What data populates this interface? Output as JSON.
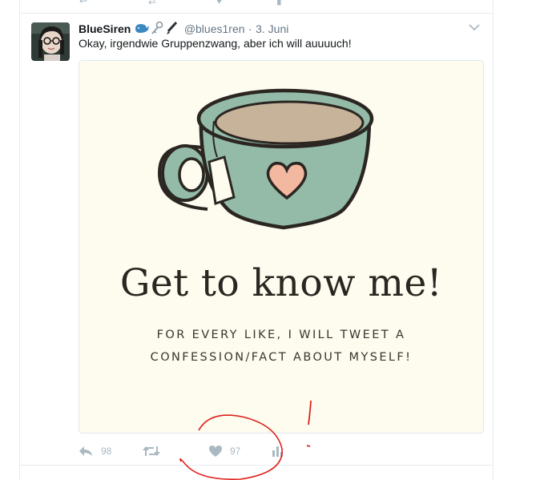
{
  "tweet": {
    "author_name": "BlueSiren",
    "author_emoji": "🐋🗝🖋",
    "handle": "@blues1ren",
    "separator": "·",
    "date": "3. Juni",
    "text": "Okay, irgendwie Gruppenzwang, aber ich will auuuuch!",
    "menu_icon": "chevron-down-icon"
  },
  "media": {
    "headline": "Get to know me!",
    "subline_1": "FOR EVERY LIKE, I WILL TWEET A",
    "subline_2": "CONFESSION/FACT ABOUT MYSELF!",
    "colors": {
      "background": "#fdfcef",
      "cup": "#94bba8",
      "tea": "#c7b39a",
      "heart": "#f2b8a0",
      "outline": "#2b2621"
    }
  },
  "actions": {
    "reply_count": "98",
    "retweet_count": "",
    "like_count": "97",
    "icons": [
      "reply-icon",
      "retweet-icon",
      "heart-icon",
      "analytics-icon"
    ]
  },
  "colors": {
    "icon_gray": "#aab8c2",
    "annotation_red": "#e0201c"
  }
}
